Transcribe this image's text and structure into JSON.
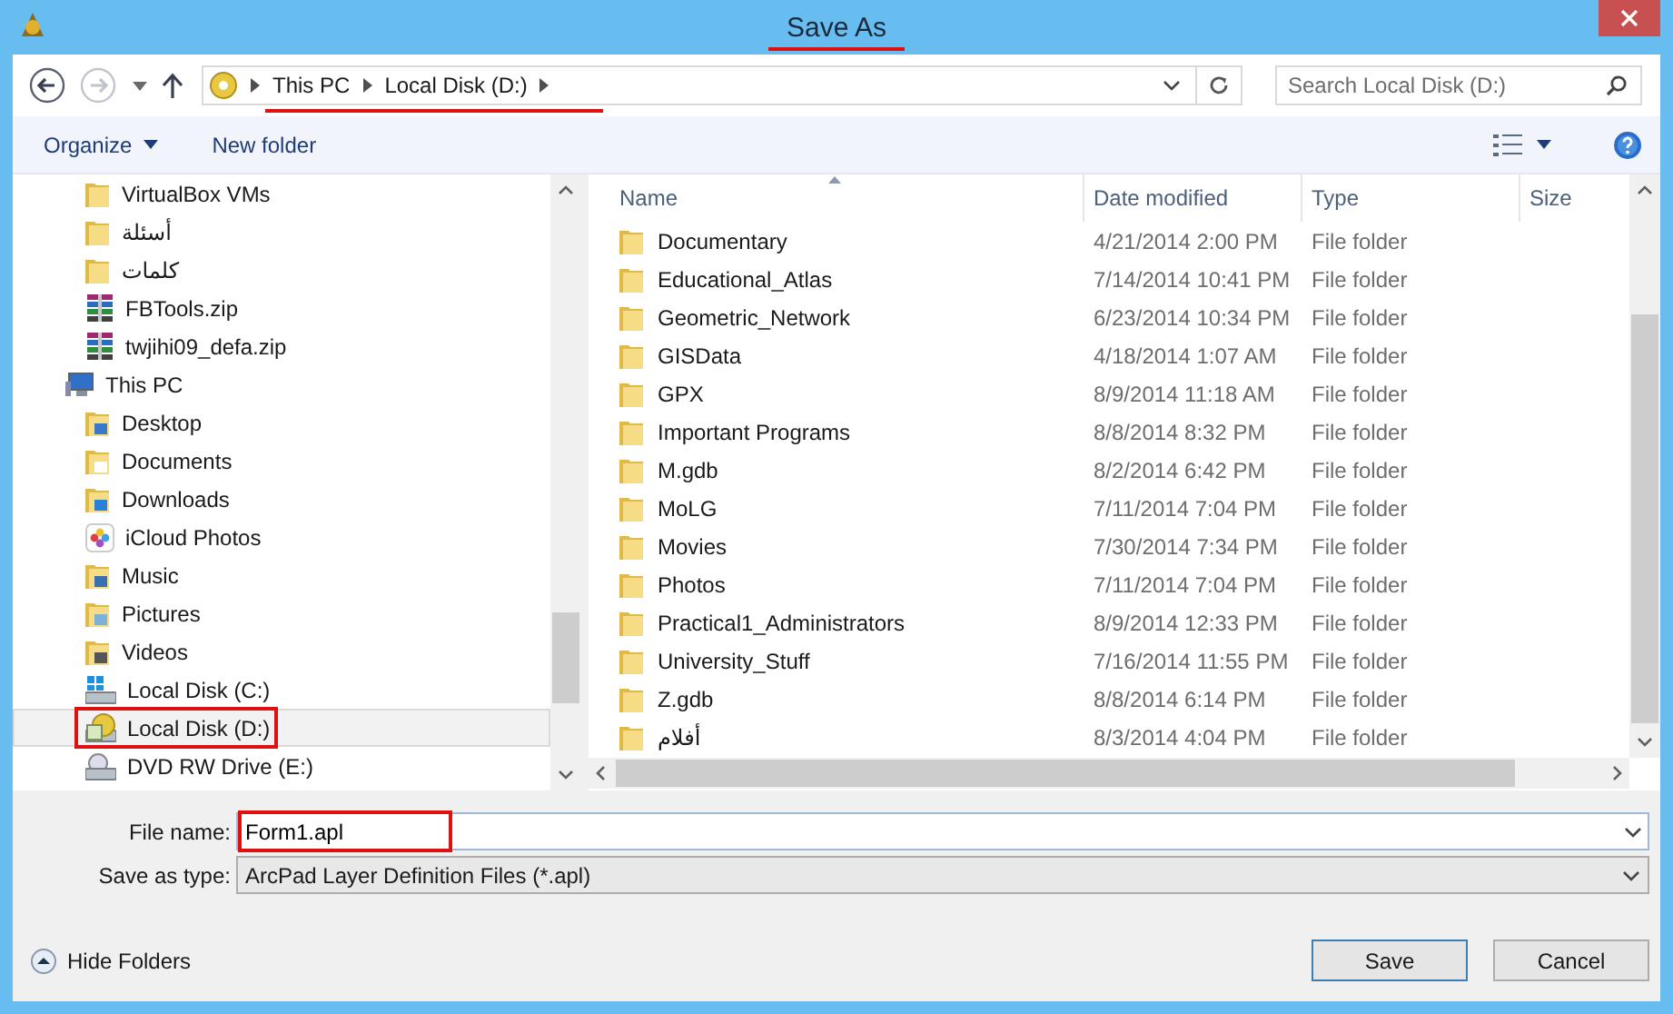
{
  "window": {
    "title": "Save As",
    "annotated": true
  },
  "address": {
    "path": [
      {
        "label": "This PC"
      },
      {
        "label": "Local Disk (D:)"
      }
    ],
    "annotated": true
  },
  "search": {
    "placeholder": "Search Local Disk (D:)"
  },
  "toolbar": {
    "organize": "Organize",
    "new_folder": "New folder"
  },
  "sidebar": {
    "items": [
      {
        "children": [
          {
            "label": "VirtualBox VMs",
            "kind": "folder",
            "selected": false,
            "annotated": false
          },
          {
            "label": "أسئلة",
            "kind": "folder",
            "selected": false,
            "annotated": false
          },
          {
            "label": "كلمات",
            "kind": "folder",
            "selected": false,
            "annotated": false
          },
          {
            "label": "FBTools.zip",
            "kind": "zip",
            "selected": false,
            "annotated": false
          },
          {
            "label": "twjihi09_defa.zip",
            "kind": "zip",
            "selected": false,
            "annotated": false
          }
        ]
      },
      {
        "label": "This PC",
        "kind": "pc",
        "selected": false,
        "annotated": false,
        "children": [
          {
            "label": "Desktop",
            "kind": "desktop",
            "selected": false,
            "annotated": false
          },
          {
            "label": "Documents",
            "kind": "documents",
            "selected": false,
            "annotated": false
          },
          {
            "label": "Downloads",
            "kind": "downloads",
            "selected": false,
            "annotated": false
          },
          {
            "label": "iCloud Photos",
            "kind": "photos",
            "selected": false,
            "annotated": false
          },
          {
            "label": "Music",
            "kind": "music",
            "selected": false,
            "annotated": false
          },
          {
            "label": "Pictures",
            "kind": "pictures",
            "selected": false,
            "annotated": false
          },
          {
            "label": "Videos",
            "kind": "videos",
            "selected": false,
            "annotated": false
          },
          {
            "label": "Local Disk (C:)",
            "kind": "drive-c",
            "selected": false,
            "annotated": false
          },
          {
            "label": "Local Disk (D:)",
            "kind": "drive-d",
            "selected": true,
            "annotated": true
          },
          {
            "label": "DVD RW Drive (E:)",
            "kind": "dvd",
            "selected": false,
            "annotated": false
          }
        ]
      }
    ]
  },
  "files": {
    "columns": [
      {
        "label": "Name",
        "sorted": true
      },
      {
        "label": "Date modified",
        "sorted": false
      },
      {
        "label": "Type",
        "sorted": false
      },
      {
        "label": "Size",
        "sorted": false
      }
    ],
    "rows": [
      {
        "name": "Documentary",
        "date": "4/21/2014 2:00 PM",
        "type": "File folder"
      },
      {
        "name": "Educational_Atlas",
        "date": "7/14/2014 10:41 PM",
        "type": "File folder"
      },
      {
        "name": "Geometric_Network",
        "date": "6/23/2014 10:34 PM",
        "type": "File folder"
      },
      {
        "name": "GISData",
        "date": "4/18/2014 1:07 AM",
        "type": "File folder"
      },
      {
        "name": "GPX",
        "date": "8/9/2014 11:18 AM",
        "type": "File folder"
      },
      {
        "name": "Important Programs",
        "date": "8/8/2014 8:32 PM",
        "type": "File folder"
      },
      {
        "name": "M.gdb",
        "date": "8/2/2014 6:42 PM",
        "type": "File folder"
      },
      {
        "name": "MoLG",
        "date": "7/11/2014 7:04 PM",
        "type": "File folder"
      },
      {
        "name": "Movies",
        "date": "7/30/2014 7:34 PM",
        "type": "File folder"
      },
      {
        "name": "Photos",
        "date": "7/11/2014 7:04 PM",
        "type": "File folder"
      },
      {
        "name": "Practical1_Administrators",
        "date": "8/9/2014 12:33 PM",
        "type": "File folder"
      },
      {
        "name": "University_Stuff",
        "date": "7/16/2014 11:55 PM",
        "type": "File folder"
      },
      {
        "name": "Z.gdb",
        "date": "8/8/2014 6:14 PM",
        "type": "File folder"
      },
      {
        "name": "أفلام",
        "date": "8/3/2014 4:04 PM",
        "type": "File folder"
      }
    ]
  },
  "form": {
    "file_name": {
      "label": "File name:",
      "value": "Form1.apl",
      "annotated": true
    },
    "save_type": {
      "label": "Save as type:",
      "value": "ArcPad Layer Definition Files (*.apl)"
    }
  },
  "hide_folders": "Hide Folders",
  "buttons": [
    {
      "label": "Save",
      "default": true
    },
    {
      "label": "Cancel",
      "default": false
    }
  ]
}
